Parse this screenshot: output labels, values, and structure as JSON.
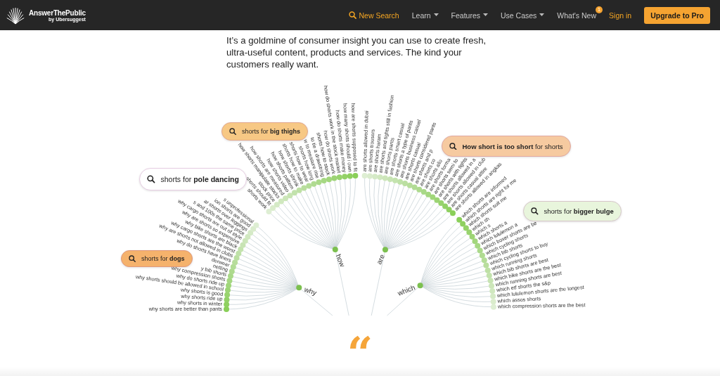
{
  "header": {
    "logo": {
      "name": "AnswerThePublic",
      "byline": "by Ubersuggest"
    },
    "nav": [
      {
        "kind": "search",
        "label": "New Search"
      },
      {
        "kind": "menu",
        "label": "Learn"
      },
      {
        "kind": "menu",
        "label": "Features"
      },
      {
        "kind": "menu",
        "label": "Use Cases"
      },
      {
        "kind": "badge",
        "label": "What's New",
        "badge": "1"
      },
      {
        "kind": "link",
        "label": "Sign in"
      },
      {
        "kind": "cta",
        "label": "Upgrade to Pro"
      }
    ]
  },
  "intro_paragraphs": [
    "It’s a goldmine of consumer insight you can use to create fresh, ultra-useful content, products and services. The kind your customers really want."
  ],
  "wheel": {
    "groups": [
      {
        "label": "why",
        "suggestions": [
          "why shorts are better than pants",
          "why shorts in winter",
          "why shorts ride up",
          "why shorts is good",
          "why shorts should be allowed in school",
          "why do shorts ride up",
          "why compression shorts",
          "y bib shorts",
          "netting",
          "derwear",
          "why do shorts have liners",
          "why are shorts not allowed in clubs",
          "why cargo shorts are the worst",
          "why bike shorts are black",
          "why are shorts so expensive",
          "why cargo shorts are out of style",
          "s and 100s the same price",
          "ar shorts over leggings",
          "ion shorts are good",
          "s unprofessional"
        ]
      },
      {
        "label": "how",
        "suggestions": [
          "shorts work",
          "shorts should fit",
          "stock price",
          "how shorts manipulate stocks",
          "how shorts are measured",
          "how shorts video",
          "how shorts pattern",
          "how shorts shrink",
          "shorts how to make",
          "shorts how to wear",
          "shorts how long",
          "w to measure rise",
          "to tie a drawstring",
          "shorts how to stock",
          "how do shorts work",
          "how do shorts work in the stock market",
          "how do shorts make money",
          "how many shorts should i own",
          "how are shorts supposed to fit"
        ]
      },
      {
        "label": "are",
        "suggestions": [
          "are shorts allowed in dubai",
          "are shorts trousers",
          "are shorts haram",
          "are shorts and tights still in fashion",
          "are shorts pants",
          "are shorts smart casual",
          "are shorts a type of pants",
          "are shorts business casual",
          "are shorts casual",
          "are shorts considered pants",
          "are shorts and p",
          "are shorts co",
          "are shorts allo",
          "are shorts forma",
          "are shorts semi fo",
          "are shorts with tights",
          "are shorts allowed in a",
          "are shorts allowed in club",
          "are shorts casual attire",
          "are shorts allowed in angkas"
        ]
      },
      {
        "label": "which",
        "suggestions": [
          "which shorts are informed",
          "which shorts are right for me",
          "which shorts suit me",
          "which sh",
          "which s",
          "which shorts a",
          "which lululemon a",
          "which boxer shorts are be",
          "which cycling shorts",
          "which bib shorts",
          "which cycling shorts to buy",
          "which running shorts",
          "which bib shorts are best",
          "which bike shorts are the best",
          "which running shorts are best",
          "which etf shorts the s&p",
          "which lululemon shorts are the longest",
          "which assos shorts",
          "which compression shorts are the best"
        ]
      }
    ]
  },
  "bubbles": [
    {
      "text": "shorts for **big thighs**",
      "color": "#f7c884"
    },
    {
      "text": "shorts for **pole dancing**",
      "color": "#ffffff"
    },
    {
      "text": "shorts for **dogs**",
      "color": "#f5b26c"
    },
    {
      "text": "**How short is too short** for shorts",
      "color": "#f6caa0"
    },
    {
      "text": "shorts for **bigger bulge**",
      "color": "#e8f5dc"
    }
  ],
  "quote_mark": "“"
}
